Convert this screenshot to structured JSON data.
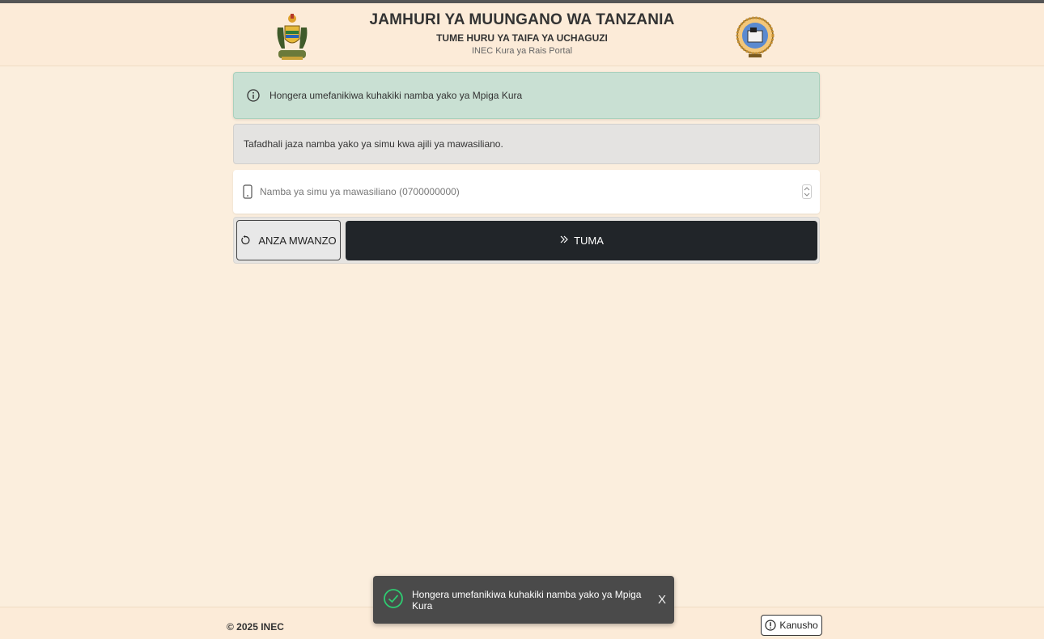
{
  "header": {
    "title": "JAMHURI YA MUUNGANO WA TANZANIA",
    "subtitle": "TUME HURU YA TAIFA YA UCHAGUZI",
    "portal": "INEC Kura ya Rais Portal"
  },
  "alerts": {
    "success": "Hongera umefanikiwa kuhakiki namba yako ya Mpiga Kura",
    "info": "Tafadhali jaza namba yako ya simu kwa ajili ya mawasiliano."
  },
  "form": {
    "phone_placeholder": "Namba ya simu ya mawasiliano (0700000000)",
    "phone_value": "",
    "reset_label": "ANZA MWANZO",
    "submit_label": "TUMA"
  },
  "footer": {
    "copyright": "© 2025 INEC",
    "disclaimer_label": "Kanusho"
  },
  "toast": {
    "message": "Hongera umefanikiwa kuhakiki namba yako ya Mpiga Kura",
    "close_label": "X"
  },
  "colors": {
    "background": "#fbeedd",
    "success_bg": "#c9e0d3",
    "info_bg": "#e4e3e1",
    "primary_button": "#212529",
    "toast_bg": "#4a4a4a",
    "toast_check": "#2ecc71"
  },
  "icons": {
    "coat_of_arms": "tanzania-coat-of-arms",
    "inec_logo": "inec-seal",
    "info": "info-circle-icon",
    "phone": "phone-icon",
    "reset": "rotate-icon",
    "submit": "double-chevron-right-icon",
    "check": "check-circle-icon",
    "disclaimer": "exclamation-circle-icon"
  }
}
